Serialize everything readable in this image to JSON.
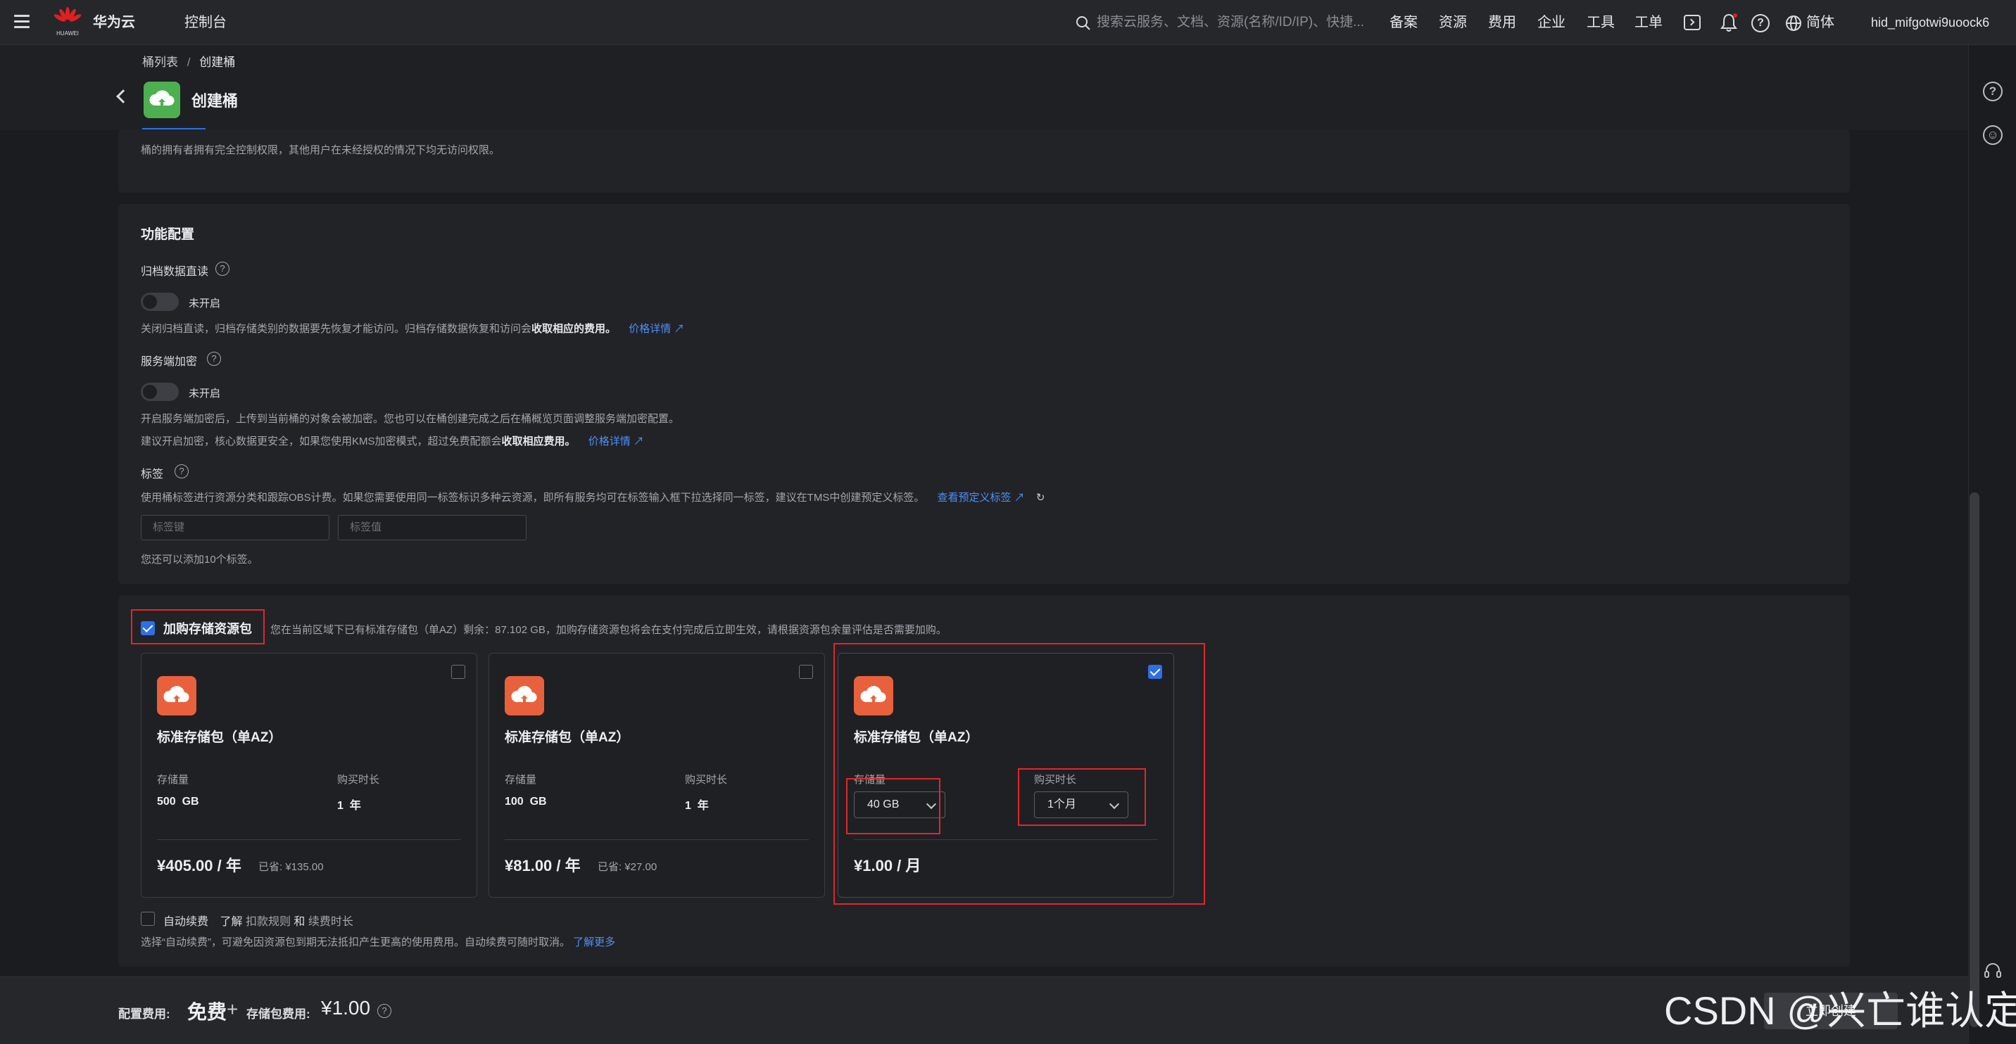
{
  "topbar": {
    "brand": "华为云",
    "brand_small": "HUAWEI",
    "console": "控制台",
    "search_placeholder": "搜索云服务、文档、资源(名称/ID/IP)、快捷...",
    "nav": [
      "备案",
      "资源",
      "费用",
      "企业",
      "工具",
      "工单"
    ],
    "language": "简体",
    "username": "hid_mifgotwi9uoock6"
  },
  "header": {
    "breadcrumb_root": "桶列表",
    "breadcrumb_sep": "/",
    "breadcrumb_current": "创建桶",
    "title": "创建桶"
  },
  "acl_note": "桶的拥有者拥有完全控制权限，其他用户在未经授权的情况下均无访问权限。",
  "features": {
    "title": "功能配置",
    "archive": {
      "label": "归档数据直读",
      "toggle_state": "未开启",
      "desc_prefix": "关闭归档直读，归档存储类别的数据要先恢复才能访问。归档存储数据恢复和访问会",
      "desc_bold": "收取相应的费用。",
      "link": "价格详情"
    },
    "encryption": {
      "label": "服务端加密",
      "toggle_state": "未开启",
      "desc1": "开启服务端加密后，上传到当前桶的对象会被加密。您也可以在桶创建完成之后在桶概览页面调整服务端加密配置。",
      "desc2_prefix": "建议开启加密，核心数据更安全，如果您使用KMS加密模式，超过免费配额会",
      "desc2_bold": "收取相应费用。",
      "link": "价格详情"
    },
    "tags": {
      "label": "标签",
      "desc": "使用桶标签进行资源分类和跟踪OBS计费。如果您需要使用同一标签标识多种云资源，即所有服务均可在标签输入框下拉选择同一标签，建议在TMS中创建预定义标签。",
      "link": "查看预定义标签",
      "key_placeholder": "标签键",
      "value_placeholder": "标签值",
      "remaining": "您还可以添加10个标签。"
    }
  },
  "package": {
    "checkbox_label": "加购存储资源包",
    "note": "您在当前区域下已有标准存储包（单AZ）剩余：87.102 GB，加购存储资源包将会在支付完成后立即生效，请根据资源包余量评估是否需要加购。",
    "cards": [
      {
        "name": "标准存储包（单AZ）",
        "storage_label": "存储量",
        "storage": "500  GB",
        "duration_label": "购买时长",
        "duration": "1  年",
        "price": "¥405.00 / 年",
        "saved": "已省: ¥135.00",
        "selected": false
      },
      {
        "name": "标准存储包（单AZ）",
        "storage_label": "存储量",
        "storage": "100  GB",
        "duration_label": "购买时长",
        "duration": "1  年",
        "price": "¥81.00 / 年",
        "saved": "已省: ¥27.00",
        "selected": false
      },
      {
        "name": "标准存储包（单AZ）",
        "storage_label": "存储量",
        "storage": "40 GB",
        "duration_label": "购买时长",
        "duration": "1个月",
        "price": "¥1.00 / 月",
        "saved": "",
        "selected": true
      }
    ],
    "auto_renew": {
      "label": "自动续费",
      "learn": "了解",
      "rule_link": "扣款规则",
      "and": "和",
      "duration_link": "续费时长",
      "desc": "选择“自动续费”，可避免因资源包到期无法抵扣产生更高的使用费用。自动续费可随时取消。",
      "more_link": "了解更多"
    }
  },
  "footer": {
    "config_label": "配置费用:",
    "config_value": "免费",
    "plus": "+",
    "pkg_label": "存储包费用:",
    "pkg_value": "¥1.00",
    "button": "立即创建"
  },
  "watermark": "CSDN @兴亡谁认定",
  "colors": {
    "accent": "#2f6fe4",
    "link": "#4e8ff6",
    "highlight_box": "#e0272b",
    "package_icon": "#e8613c",
    "bucket_icon": "#4caf50"
  }
}
